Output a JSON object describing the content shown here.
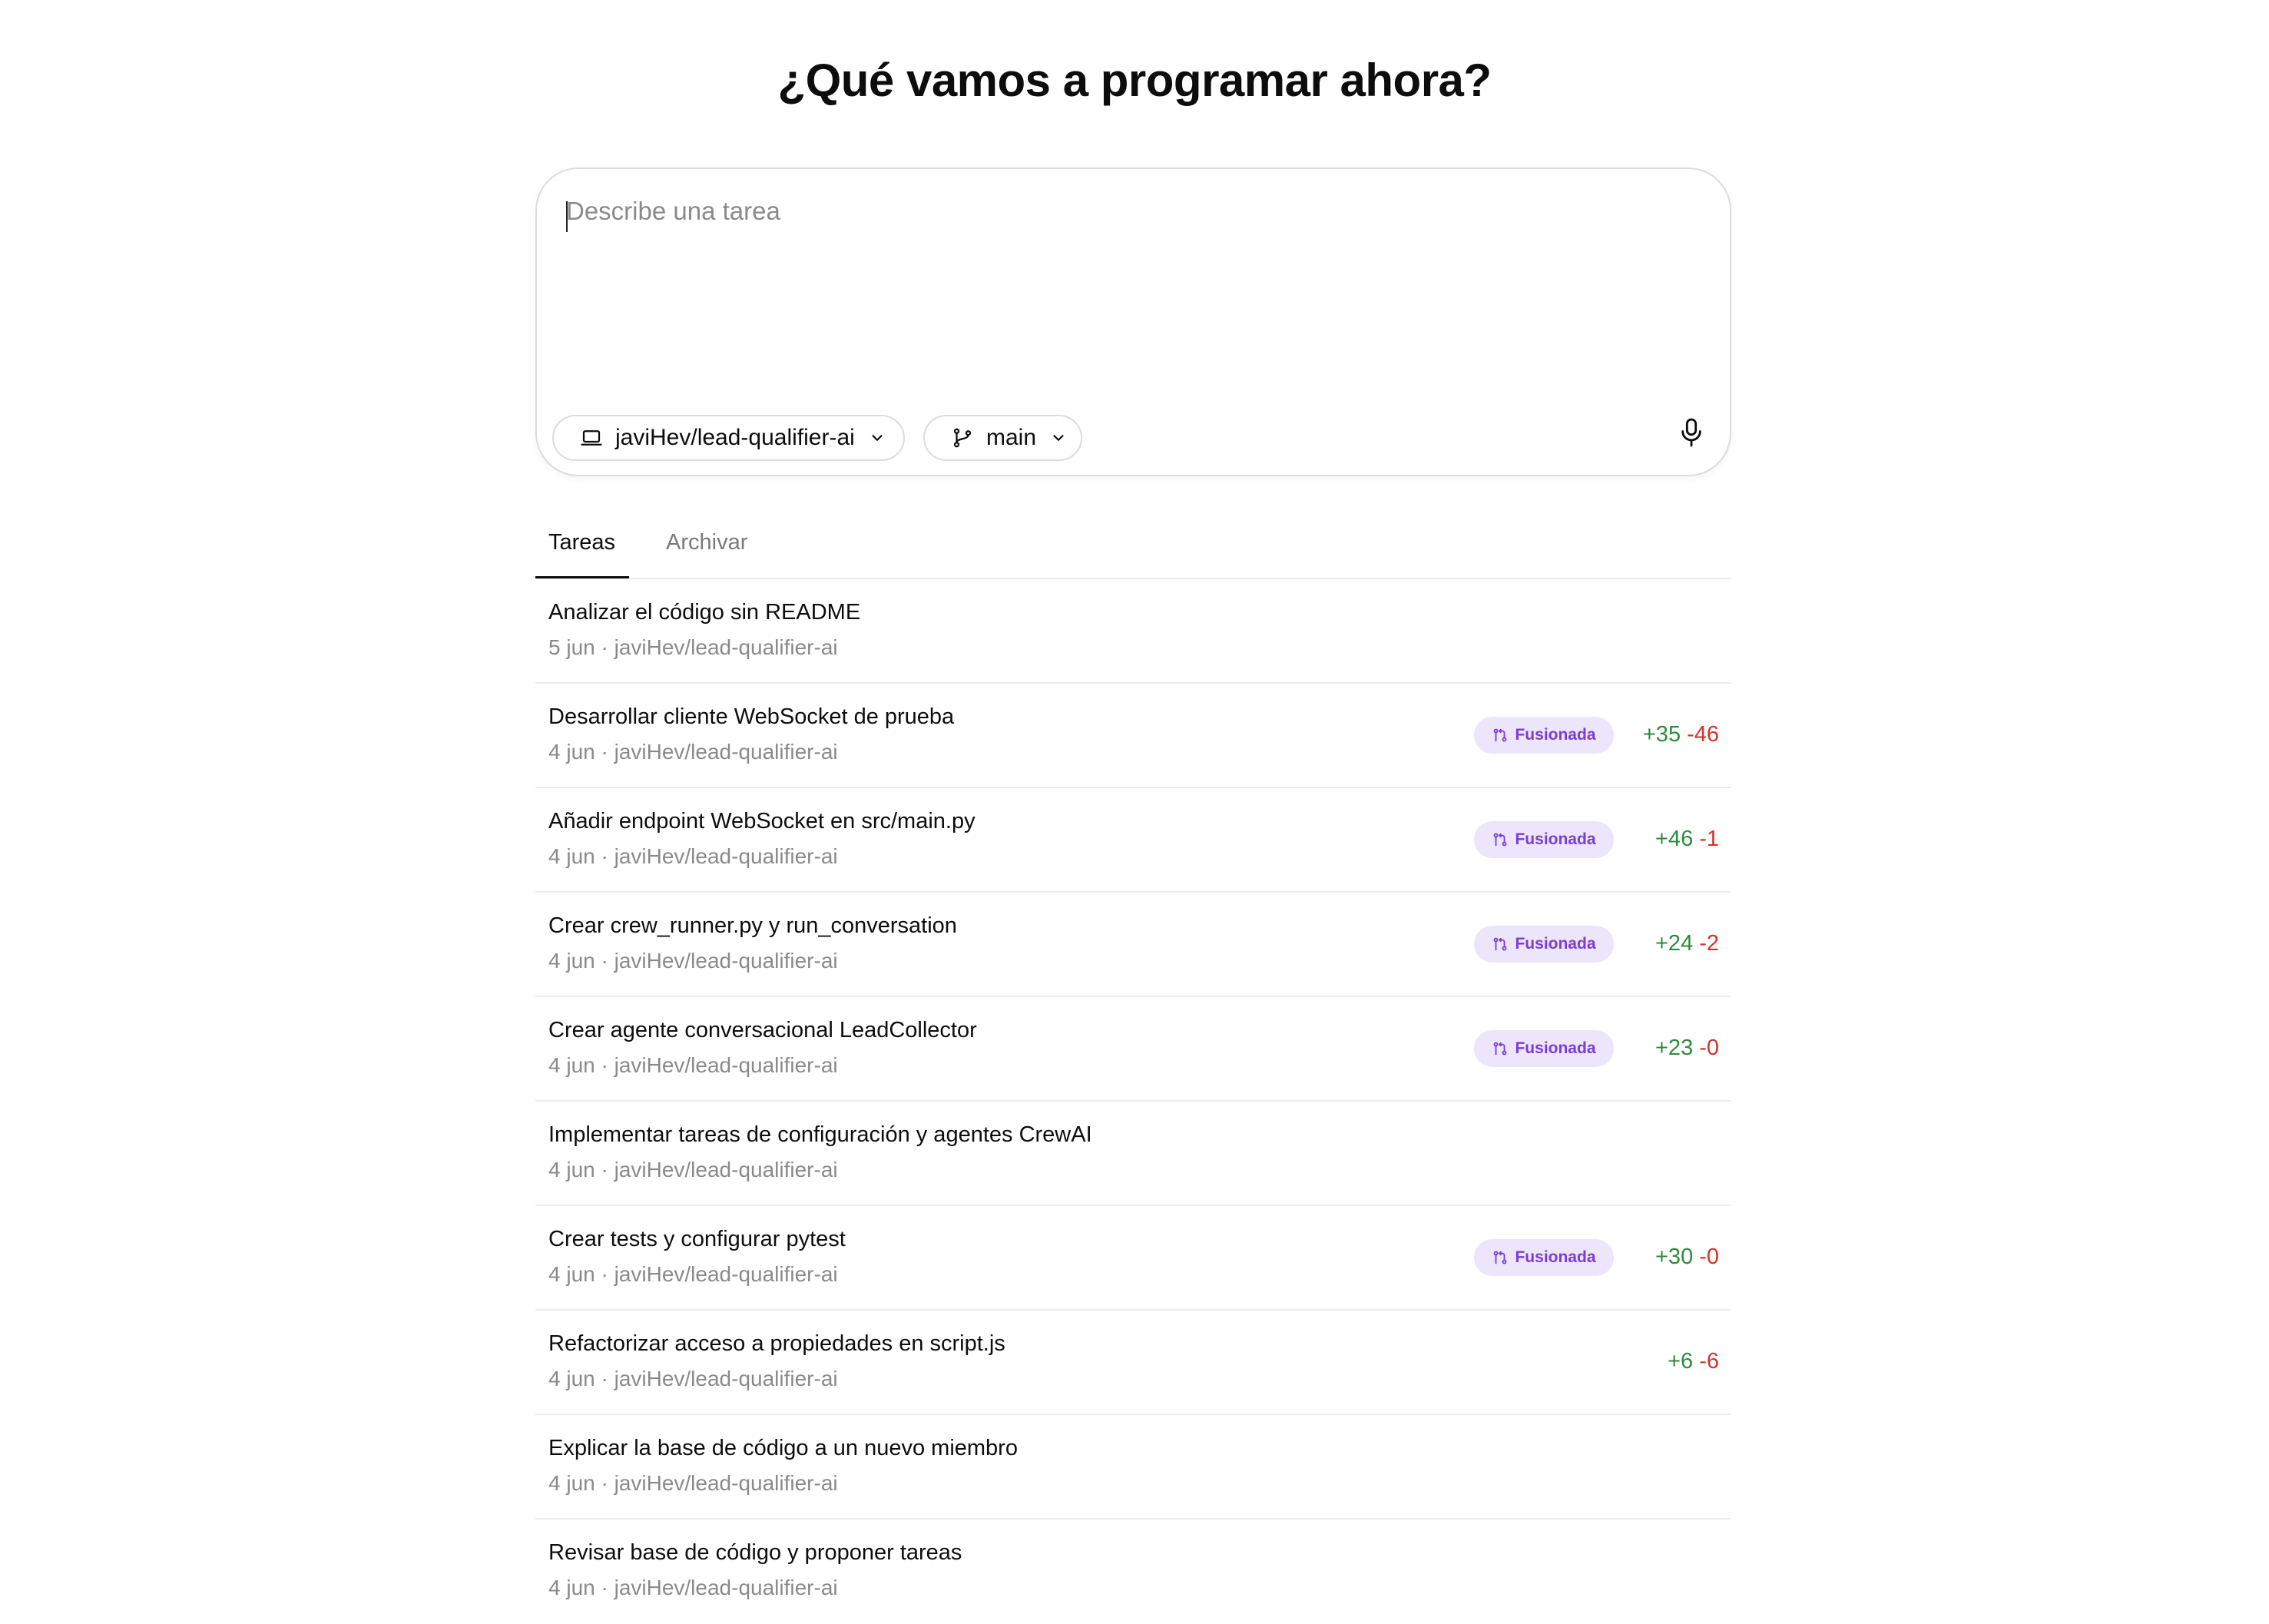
{
  "heading": "¿Qué vamos a programar ahora?",
  "composer": {
    "placeholder": "Describe una tarea",
    "repo": "javiHev/lead-qualifier-ai",
    "branch": "main"
  },
  "tabs": {
    "active": "Tareas",
    "inactive": "Archivar"
  },
  "tasks": [
    {
      "title": "Analizar el código sin README",
      "meta": "5 jun · javiHev/lead-qualifier-ai",
      "badge": "",
      "add": "",
      "del": ""
    },
    {
      "title": "Desarrollar cliente WebSocket de prueba",
      "meta": "4 jun · javiHev/lead-qualifier-ai",
      "badge": "Fusionada",
      "add": "+35",
      "del": "-46"
    },
    {
      "title": "Añadir endpoint WebSocket en src/main.py",
      "meta": "4 jun · javiHev/lead-qualifier-ai",
      "badge": "Fusionada",
      "add": "+46",
      "del": "-1"
    },
    {
      "title": "Crear crew_runner.py y run_conversation",
      "meta": "4 jun · javiHev/lead-qualifier-ai",
      "badge": "Fusionada",
      "add": "+24",
      "del": "-2"
    },
    {
      "title": "Crear agente conversacional LeadCollector",
      "meta": "4 jun · javiHev/lead-qualifier-ai",
      "badge": "Fusionada",
      "add": "+23",
      "del": "-0"
    },
    {
      "title": "Implementar tareas de configuración y agentes CrewAI",
      "meta": "4 jun · javiHev/lead-qualifier-ai",
      "badge": "",
      "add": "",
      "del": ""
    },
    {
      "title": "Crear tests y configurar pytest",
      "meta": "4 jun · javiHev/lead-qualifier-ai",
      "badge": "Fusionada",
      "add": "+30",
      "del": "-0"
    },
    {
      "title": "Refactorizar acceso a propiedades en script.js",
      "meta": "4 jun · javiHev/lead-qualifier-ai",
      "badge": "",
      "add": "+6",
      "del": "-6"
    },
    {
      "title": "Explicar la base de código a un nuevo miembro",
      "meta": "4 jun · javiHev/lead-qualifier-ai",
      "badge": "",
      "add": "",
      "del": ""
    },
    {
      "title": "Revisar base de código y proponer tareas",
      "meta": "4 jun · javiHev/lead-qualifier-ai",
      "badge": "",
      "add": "",
      "del": ""
    }
  ],
  "colors": {
    "add": "#2e8b3d",
    "del": "#d0352b",
    "badge_bg": "#ede5fb",
    "badge_text": "#7a3dd1"
  },
  "icons": {
    "repo": "laptop-icon",
    "branch": "git-branch-icon",
    "chevron": "chevron-down-icon",
    "mic": "microphone-icon",
    "merged": "git-merge-icon"
  }
}
